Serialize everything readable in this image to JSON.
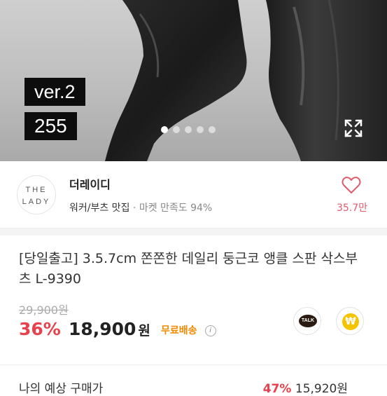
{
  "hero": {
    "tags": [
      "ver.2",
      "255"
    ],
    "dots": {
      "count": 5,
      "active_index": 0
    },
    "expand_icon": "expand-arrows-icon"
  },
  "seller": {
    "logo_line1": "THE",
    "logo_line2": "LADY",
    "name": "더레이디",
    "category": "워커/부츠 맛집",
    "separator": "·",
    "rating_text": "마켓 만족도 94%",
    "like_count": "35.7만",
    "accent_color": "#e05a6a"
  },
  "product": {
    "title": "[당일출고] 3.5.7cm 쫀쫀한 데일리 둥근코 앵클 스판 삭스부츠 L-9390",
    "original_price": "29,900원",
    "discount": "36%",
    "price": "18,900",
    "currency": "원",
    "shipping": "무료배송",
    "info_icon": "info-icon"
  },
  "share": {
    "kakao_label": "TALK",
    "pay_symbol": "₩"
  },
  "next_row": {
    "left": "나의 예상 구매가",
    "discount": "47%",
    "price": "15,920원"
  }
}
